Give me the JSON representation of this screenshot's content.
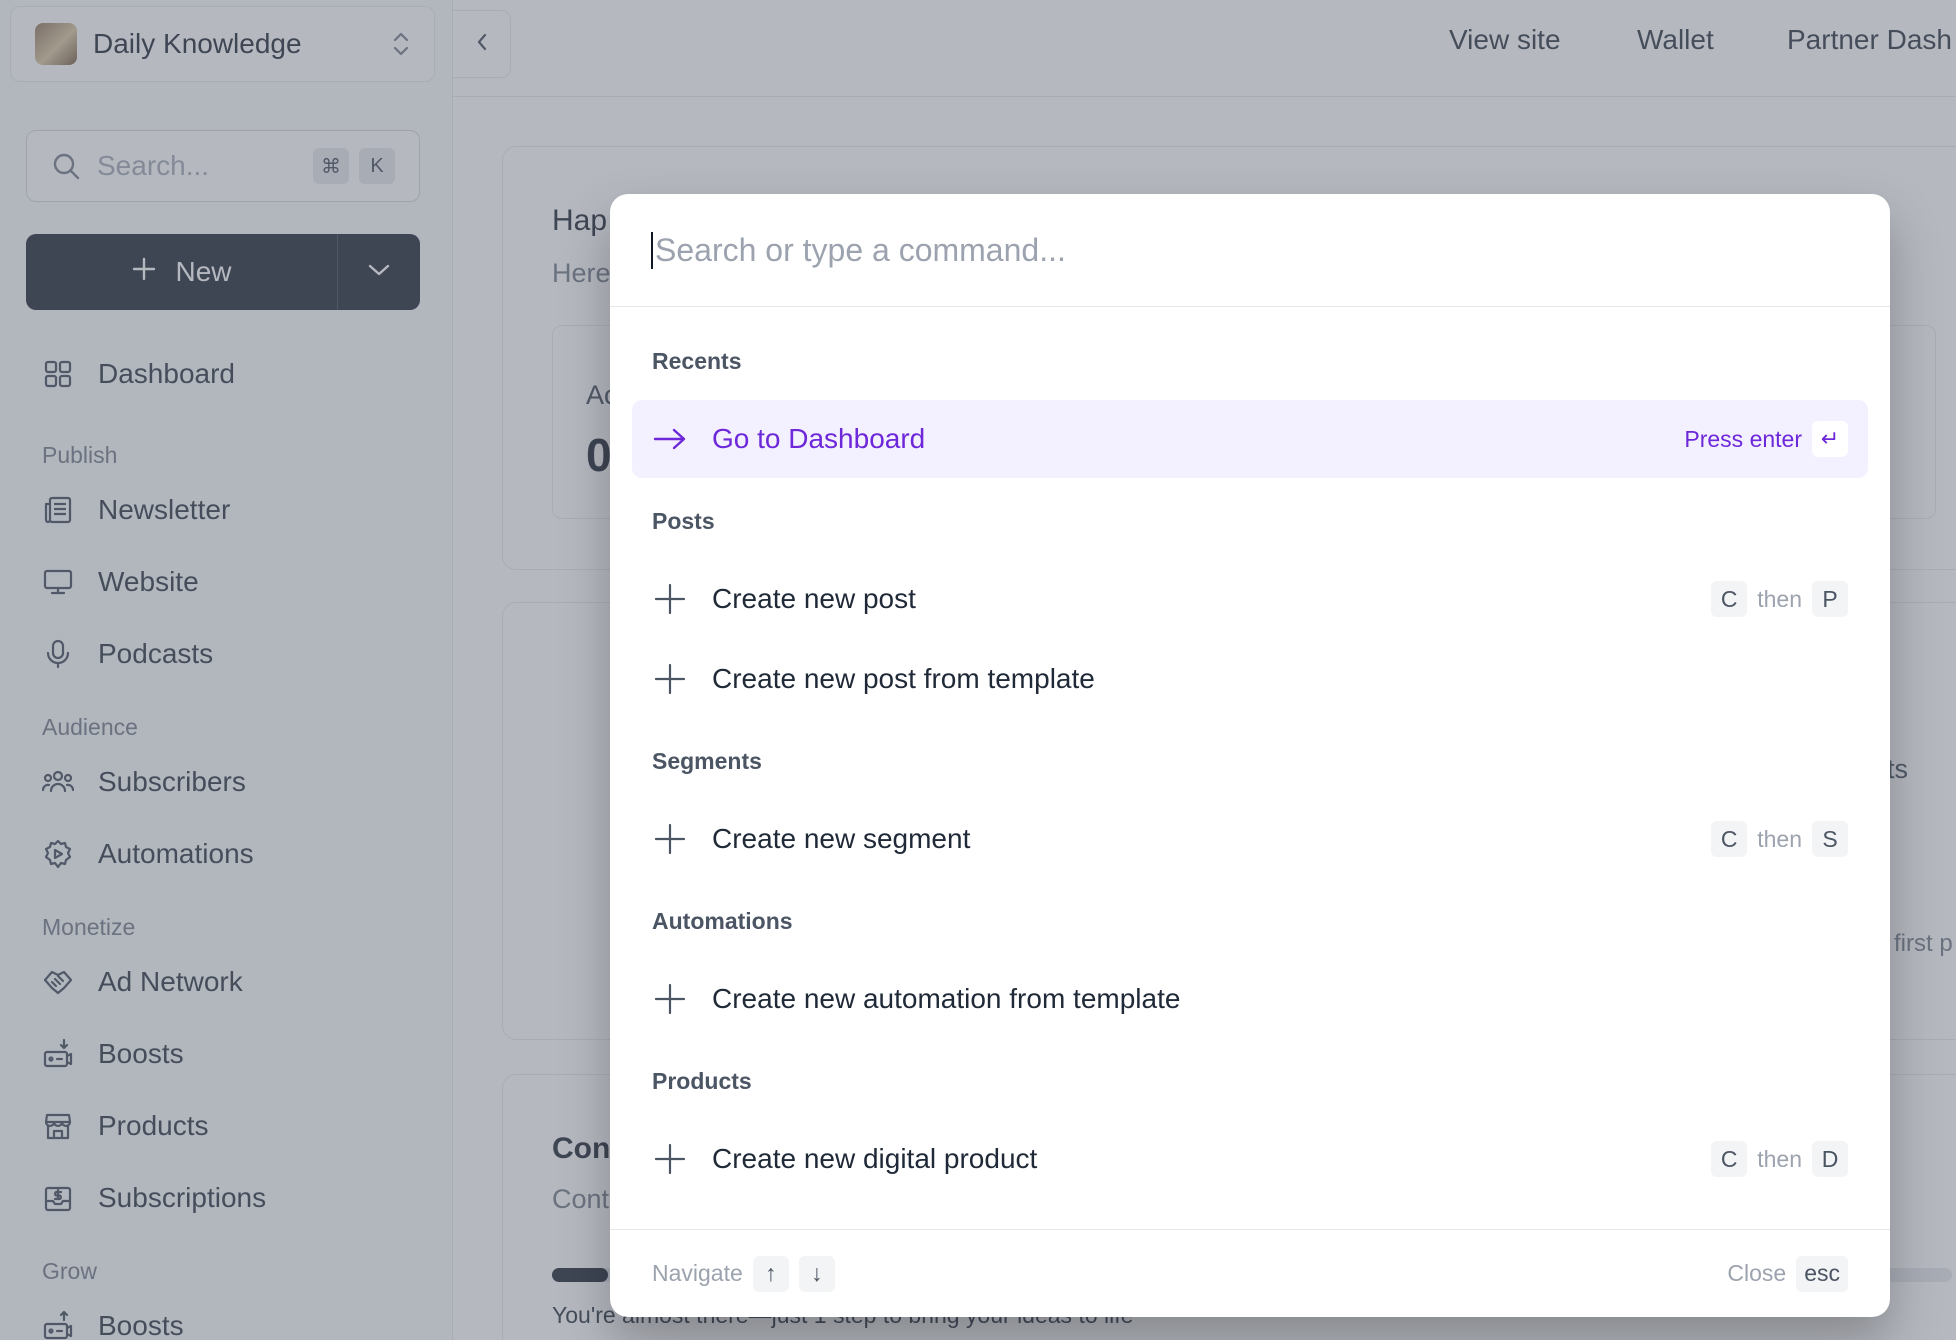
{
  "sidebar": {
    "workspace_name": "Daily Knowledge",
    "search_placeholder": "Search...",
    "search_kbd_1": "⌘",
    "search_kbd_2": "K",
    "new_label": "New",
    "dashboard": "Dashboard",
    "sections": {
      "publish": "Publish",
      "audience": "Audience",
      "monetize": "Monetize",
      "grow": "Grow"
    },
    "items": {
      "newsletter": "Newsletter",
      "website": "Website",
      "podcasts": "Podcasts",
      "subscribers": "Subscribers",
      "automations": "Automations",
      "ad_network": "Ad Network",
      "boosts": "Boosts",
      "products": "Products",
      "subscriptions": "Subscriptions",
      "grow_boosts": "Boosts"
    }
  },
  "topbar": {
    "view_site": "View site",
    "wallet": "Wallet",
    "partner": "Partner Dash"
  },
  "background": {
    "greeting_fragment": "Hap",
    "here_fragment": "Here",
    "ac_fragment": "Ac",
    "zero_fragment": "0",
    "nts_fragment": "nts",
    "first_fragment": "first p",
    "con_fragment": "Con",
    "cont_fragment": "Cont",
    "almost": "You're almost there—just 1 step to bring your ideas to life"
  },
  "palette": {
    "placeholder": "Search or type a command...",
    "groups": {
      "recents": "Recents",
      "posts": "Posts",
      "segments": "Segments",
      "automations": "Automations",
      "products": "Products"
    },
    "items": {
      "go_dashboard": "Go to Dashboard",
      "create_post": "Create new post",
      "create_post_template": "Create new post from template",
      "create_segment": "Create new segment",
      "create_automation_template": "Create new automation from template",
      "create_digital_product": "Create new digital product"
    },
    "press_enter": "Press enter",
    "enter_key": "↵",
    "then": "then",
    "keys": {
      "c": "C",
      "p": "P",
      "s": "S",
      "d": "D"
    },
    "footer": {
      "navigate": "Navigate",
      "up": "↑",
      "down": "↓",
      "close": "Close",
      "esc": "esc"
    }
  },
  "colors": {
    "accent": "#6d28d9",
    "active_bg": "#f3f0ff",
    "primary_button": "#111827"
  }
}
